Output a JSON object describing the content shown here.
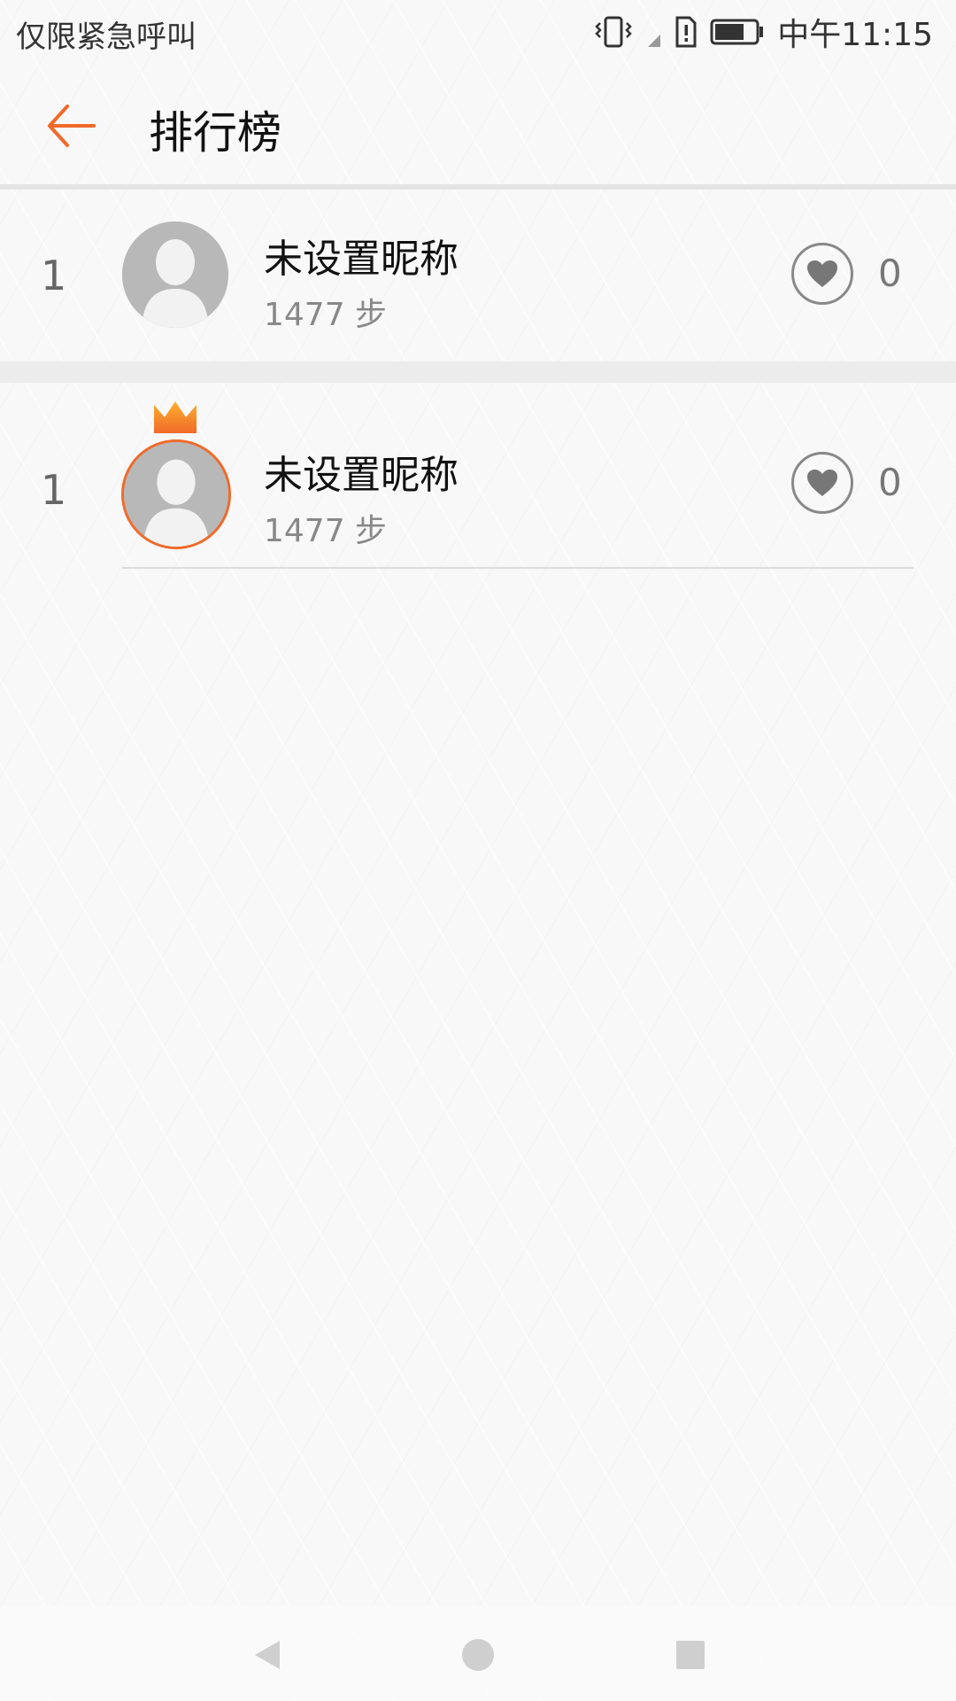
{
  "status_bar": {
    "carrier_text": "仅限紧急呼叫",
    "time": "中午11:15",
    "icons": [
      "vibrate-icon",
      "signal-icon",
      "sim-alert-icon",
      "battery-icon"
    ]
  },
  "header": {
    "title": "排行榜",
    "back_icon": "arrow-left-icon"
  },
  "rows": [
    {
      "rank": "1",
      "name": "未设置昵称",
      "steps": "1477 步",
      "likes": "0",
      "highlighted": false
    },
    {
      "rank": "1",
      "name": "未设置昵称",
      "steps": "1477 步",
      "likes": "0",
      "highlighted": true
    }
  ],
  "nav_bar": {
    "icons": [
      "nav-back-icon",
      "nav-home-icon",
      "nav-recent-icon"
    ]
  },
  "colors": {
    "accent": "#f06a2a",
    "background": "#f8f8f8",
    "text_primary": "#111111",
    "text_secondary": "#888888"
  }
}
